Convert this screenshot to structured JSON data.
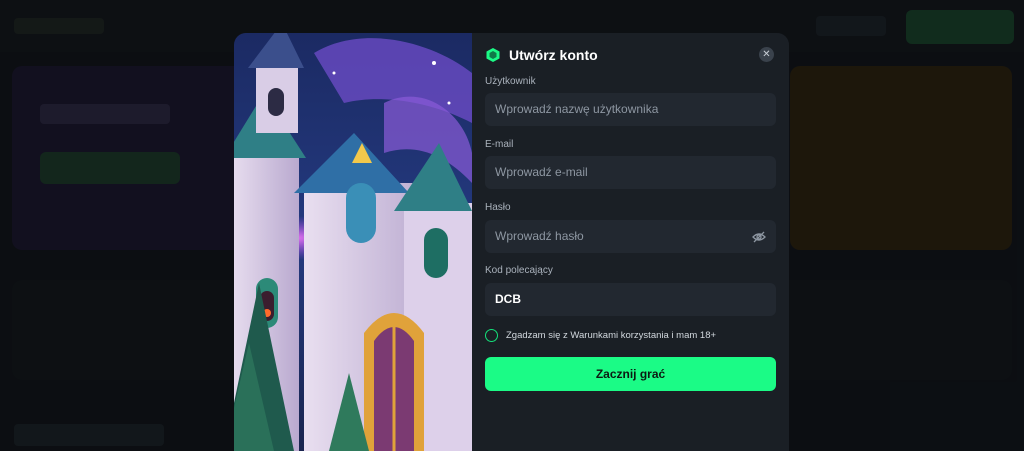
{
  "modal": {
    "title": "Utwórz konto",
    "close_icon": "close-icon",
    "brand_icon": "hexagon-logo-icon",
    "accent_color": "#1bfb86",
    "fields": {
      "username": {
        "label": "Użytkownik",
        "placeholder": "Wprowadź nazwę użytkownika",
        "value": ""
      },
      "email": {
        "label": "E-mail",
        "placeholder": "Wprowadź e-mail",
        "value": ""
      },
      "password": {
        "label": "Hasło",
        "placeholder": "Wprowadź hasło",
        "value": "",
        "toggle_icon": "eye-slash-icon"
      },
      "referral": {
        "label": "Kod polecający",
        "placeholder": "",
        "value": "DCB"
      }
    },
    "terms_label": "Zgadzam się z Warunkami korzystania i mam 18+",
    "terms_checked": false,
    "submit_label": "Zacznij grać"
  }
}
